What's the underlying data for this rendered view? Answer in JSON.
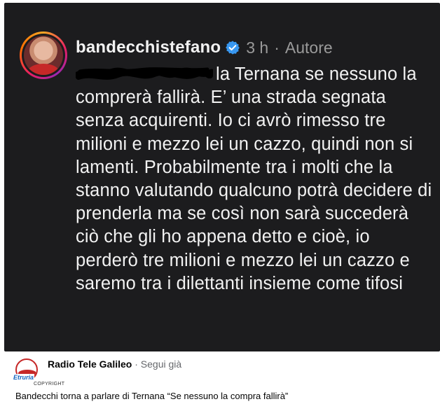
{
  "post": {
    "username": "bandecchistefano",
    "time": "3 h",
    "separator": "·",
    "role": "Autore",
    "body": "la Ternana se nessuno la comprerà fallirà. E’ una strada segnata senza acquirenti. Io ci avrò rimesso tre milioni e mezzo lei un cazzo, quindi non si lamenti. Probabilmente tra i molti che la stanno valutando qualcuno potrà decidere di prenderla ma se così non sarà succederà ciò che gli ho appena detto e cioè, io perderò tre milioni e mezzo lei un cazzo e saremo tra i dilettanti insieme come tifosi"
  },
  "source": {
    "logo_word": "Etruria",
    "logo_copyright": "COPYRIGHT",
    "name": "Radio Tele Galileo",
    "separator": "·",
    "follow": "Segui già"
  },
  "caption": "Bandecchi torna a parlare di Ternana “Se nessuno la compra fallirà”",
  "colors": {
    "post_background": "#1c1c1e",
    "verified_blue": "#3897f0",
    "text_light": "#f2f2f2",
    "meta_gray": "#9a9a9a",
    "logo_red": "#c62828",
    "logo_blue": "#1565c0"
  },
  "icons": {
    "verified": "verified-badge-icon",
    "redaction": "scribble-redaction-icon"
  }
}
